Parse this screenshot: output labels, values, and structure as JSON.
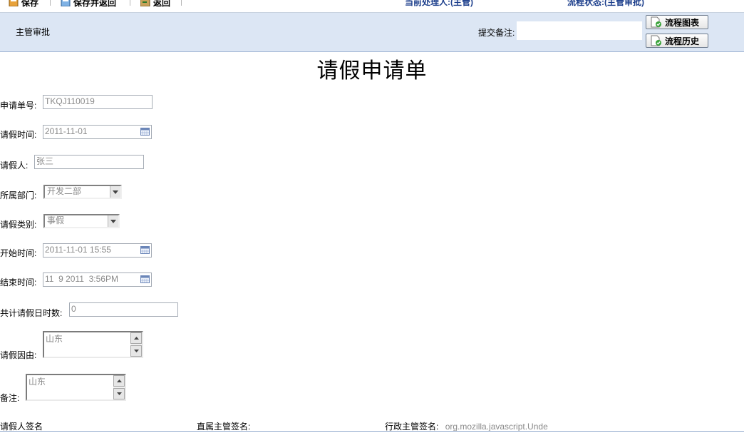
{
  "toolbar": {
    "save": "保存",
    "save_return": "保存并返回",
    "back": "返回",
    "handler": "当前处理人:(主管)",
    "status": "流程状态:(主管审批)"
  },
  "panel": {
    "step": "主管审批",
    "remark_label": "提交备注:",
    "remark_value": "",
    "flow_chart": "流程图表",
    "flow_history": "流程历史"
  },
  "form": {
    "title": "请假申请单",
    "order_no_label": "申请单号:",
    "order_no": "TKQJ110019",
    "leave_time_label": "请假时间:",
    "leave_time": "2011-11-01",
    "applicant_label": "请假人:",
    "applicant": "张三",
    "dept_label": "所属部门:",
    "dept": "开发二部",
    "type_label": "请假类别:",
    "type": "事假",
    "start_label": "开始时间:",
    "start": "2011-11-01 15:55",
    "end_label": "结束时间:",
    "end": "11  9 2011  3:56PM",
    "total_label": "共计请假日时数:",
    "total": "0",
    "reason_label": "请假因由:",
    "reason": "山东",
    "note_label": "备注:",
    "note": "山东"
  },
  "signatures": {
    "applicant_sig": "请假人签名",
    "supervisor_sig": "直属主管签名:",
    "admin_sig": "行政主管签名:",
    "admin_sig_value": "org.mozilla.javascript.Unde"
  }
}
